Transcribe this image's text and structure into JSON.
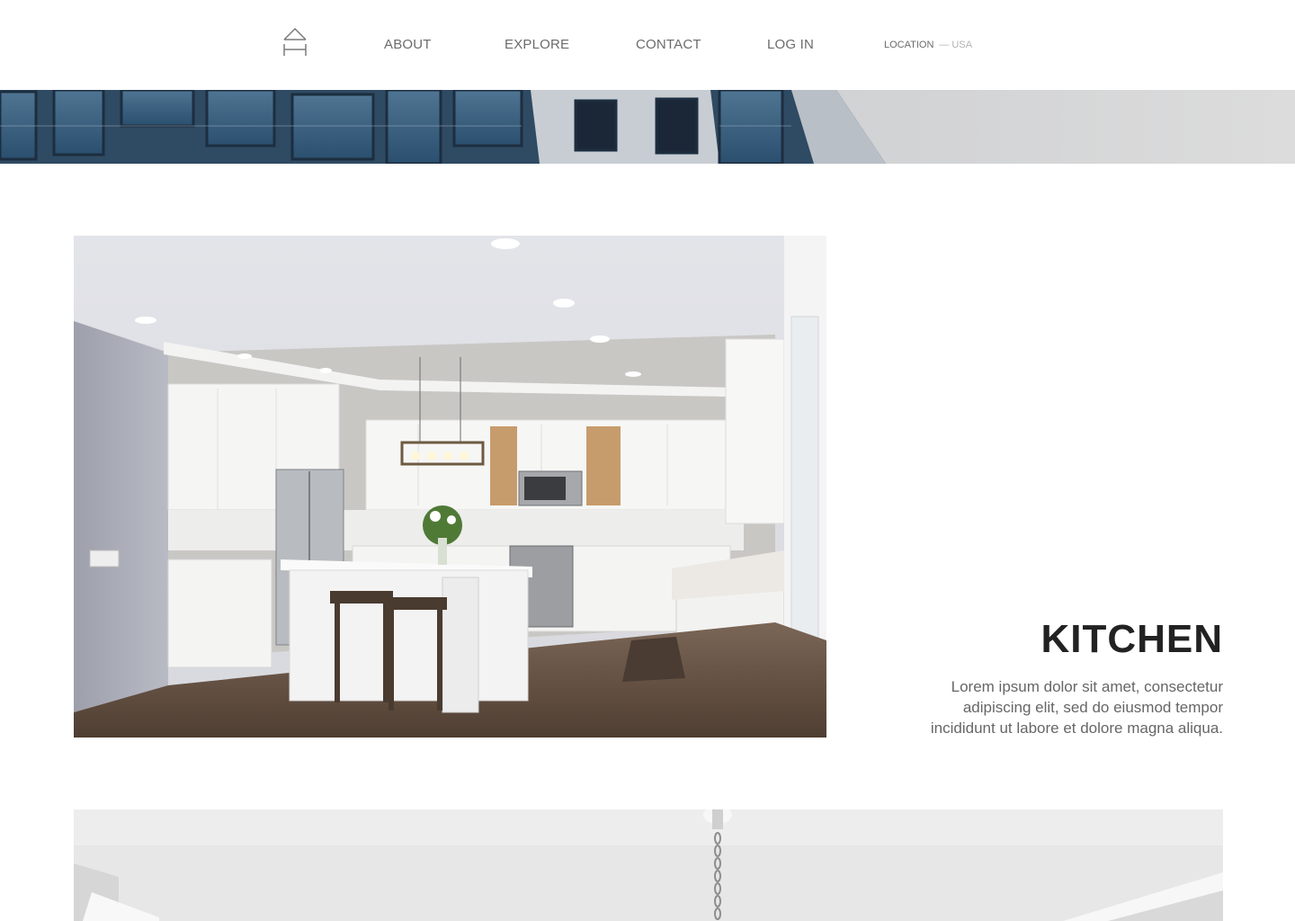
{
  "nav": {
    "logo_icon": "house-outline-icon",
    "items": [
      {
        "label": "ABOUT"
      },
      {
        "label": "EXPLORE"
      },
      {
        "label": "CONTACT"
      },
      {
        "label": "LOG IN"
      }
    ],
    "location_label": "LOCATION",
    "location_separator": "—",
    "location_value": "USA"
  },
  "banner": {
    "image": "building-facade-image"
  },
  "feature": {
    "image": "kitchen-interior-image",
    "title": "KITCHEN",
    "description": "Lorem ipsum dolor sit amet, consectetur adipiscing elit, sed do eiusmod tempor incididunt ut labore et dolore magna aliqua."
  },
  "next_feature": {
    "image": "ceiling-pendant-image"
  },
  "colors": {
    "text_dark": "#222222",
    "text_muted": "#666666",
    "nav_text": "#6b6b6b",
    "background": "#ffffff"
  }
}
